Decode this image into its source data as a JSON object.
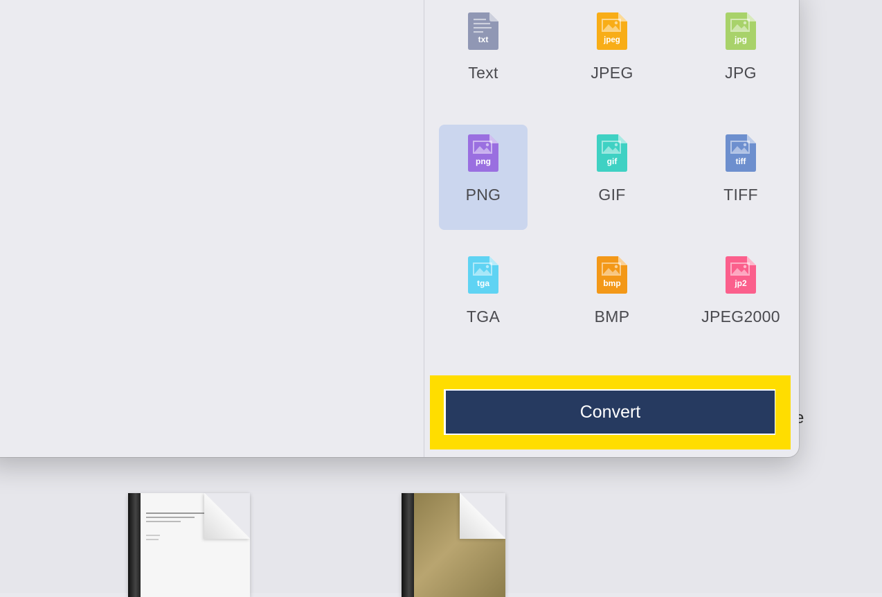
{
  "formats": [
    {
      "name": "Text",
      "badge": "txt",
      "color": "#9097b4",
      "kind": "text",
      "selected": false
    },
    {
      "name": "JPEG",
      "badge": "jpeg",
      "color": "#f8ad17",
      "kind": "image",
      "selected": false
    },
    {
      "name": "JPG",
      "badge": "jpg",
      "color": "#a8d26a",
      "kind": "image",
      "selected": false
    },
    {
      "name": "PNG",
      "badge": "png",
      "color": "#9a6fe0",
      "kind": "image",
      "selected": true
    },
    {
      "name": "GIF",
      "badge": "gif",
      "color": "#3fd1c3",
      "kind": "image",
      "selected": false
    },
    {
      "name": "TIFF",
      "badge": "tiff",
      "color": "#6d8fce",
      "kind": "image",
      "selected": false
    },
    {
      "name": "TGA",
      "badge": "tga",
      "color": "#5fd3f3",
      "kind": "image",
      "selected": false
    },
    {
      "name": "BMP",
      "badge": "bmp",
      "color": "#f39818",
      "kind": "image",
      "selected": false
    },
    {
      "name": "JPEG2000",
      "badge": "jp2",
      "color": "#fb5f8c",
      "kind": "image",
      "selected": false
    }
  ],
  "convert_label": "Convert",
  "peek_letter": "e",
  "colors": {
    "highlight": "#ffdd00",
    "button": "#263a60",
    "selected_tile": "#cbd6ee"
  }
}
